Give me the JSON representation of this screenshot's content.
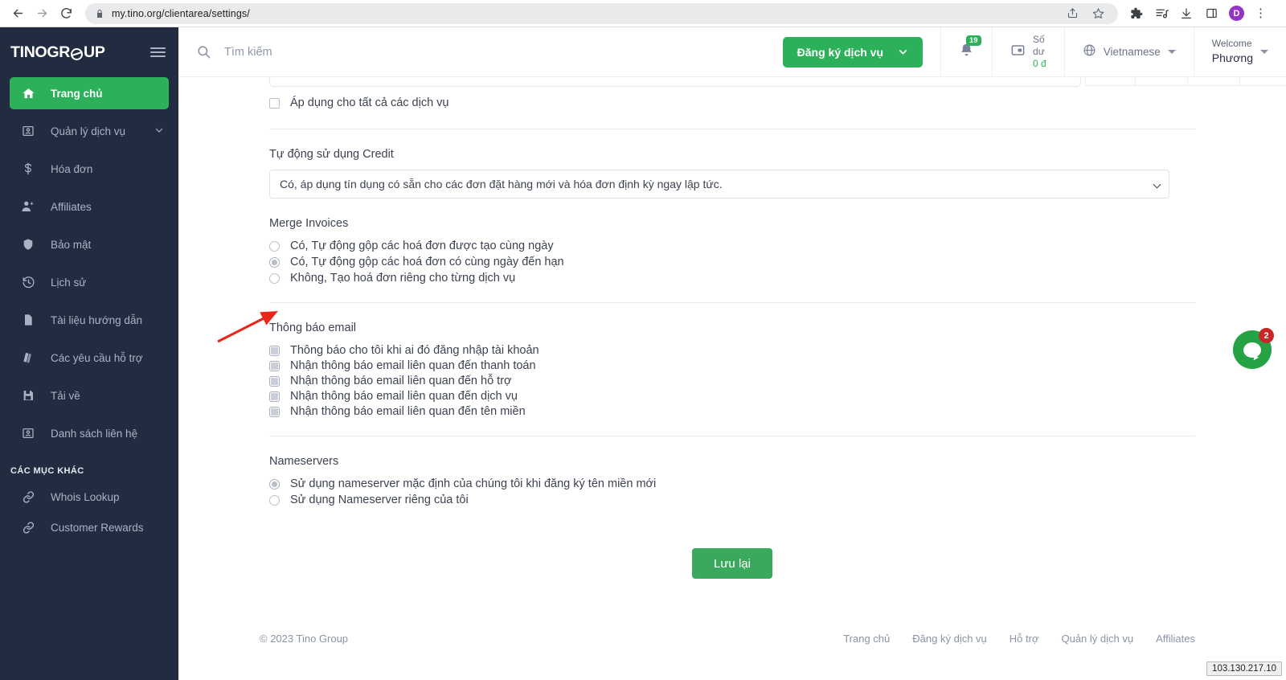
{
  "browser": {
    "back_icon": "back-arrow-icon",
    "forward_icon": "forward-arrow-icon",
    "reload_icon": "reload-icon",
    "url": "my.tino.org/clientarea/settings/",
    "lock_icon": "lock-icon",
    "share_icon": "share-icon",
    "bookmark_icon": "star-icon",
    "extensions_icon": "puzzle-piece-icon",
    "readinglist_icon": "reading-list-icon",
    "downloads_icon": "download-icon",
    "sidepanel_icon": "side-panel-icon",
    "profile_initial": "D",
    "menu_icon": "kebab-menu-icon"
  },
  "sidebar": {
    "brand": {
      "part1": "TINO",
      "part2": "GR",
      "part3": "UP"
    },
    "menu_icon": "hamburger-icon",
    "items": [
      {
        "label": "Trang chủ",
        "icon": "home-icon",
        "active": true,
        "chevron": false
      },
      {
        "label": "Quản lý dịch vụ",
        "icon": "id-card-icon",
        "active": false,
        "chevron": true
      },
      {
        "label": "Hóa đơn",
        "icon": "dollar-icon",
        "active": false,
        "chevron": false
      },
      {
        "label": "Affiliates",
        "icon": "user-plus-icon",
        "active": false,
        "chevron": false
      },
      {
        "label": "Bảo mật",
        "icon": "shield-icon",
        "active": false,
        "chevron": false
      },
      {
        "label": "Lịch sử",
        "icon": "history-clock-icon",
        "active": false,
        "chevron": false
      },
      {
        "label": "Tài liệu hướng dẫn",
        "icon": "document-icon",
        "active": false,
        "chevron": false
      },
      {
        "label": "Các yêu cầu hỗ trợ",
        "icon": "books-icon",
        "active": false,
        "chevron": false
      },
      {
        "label": "Tải về",
        "icon": "save-disk-icon",
        "active": false,
        "chevron": false
      },
      {
        "label": "Danh sách liên hệ",
        "icon": "contact-card-icon",
        "active": false,
        "chevron": false
      }
    ],
    "section_title": "CÁC MỤC KHÁC",
    "other_items": [
      {
        "label": "Whois Lookup",
        "icon": "link-icon"
      },
      {
        "label": "Customer Rewards",
        "icon": "link-icon"
      }
    ]
  },
  "topbar": {
    "search_placeholder": "Tìm kiếm",
    "search_value": "",
    "search_icon": "search-icon",
    "register_button": "Đăng ký dịch vụ",
    "register_chevron": "chevron-down-icon",
    "bell_icon": "bell-icon",
    "notification_count": "19",
    "wallet_icon": "wallet-icon",
    "balance_label_line1": "Số",
    "balance_label_line2": "dư",
    "balance_amount": "0 đ",
    "language_icon": "globe-icon",
    "language": "Vietnamese",
    "welcome_label": "Welcome",
    "user_name": "Phương"
  },
  "main": {
    "apply_all_services": {
      "label": "Áp dụng cho tất cả các dịch vụ",
      "checked": false
    },
    "auto_credit": {
      "label": "Tự động sử dụng Credit",
      "selected": "Có, áp dụng tín dụng có sẵn cho các đơn đặt hàng mới và hóa đơn định kỳ ngay lập tức."
    },
    "merge_invoices": {
      "title": "Merge Invoices",
      "options": [
        {
          "label": "Có, Tự động gộp các hoá đơn được tạo cùng ngày",
          "selected": false
        },
        {
          "label": "Có, Tự động gộp các hoá đơn có cùng ngày đến hạn",
          "selected": true
        },
        {
          "label": "Không, Tạo hoá đơn riêng cho từng dịch vụ",
          "selected": false
        }
      ]
    },
    "email_notifications": {
      "title": "Thông báo email",
      "options": [
        {
          "label": "Thông báo cho tôi khi ai đó đăng nhập tài khoản",
          "checked": true
        },
        {
          "label": "Nhận thông báo email liên quan đến thanh toán",
          "checked": true
        },
        {
          "label": "Nhận thông báo email liên quan đến hỗ trợ",
          "checked": true
        },
        {
          "label": "Nhận thông báo email liên quan đến dịch vụ",
          "checked": true
        },
        {
          "label": "Nhận thông báo email liên quan đến tên miền",
          "checked": true
        }
      ]
    },
    "nameservers": {
      "title": "Nameservers",
      "options": [
        {
          "label": "Sử dụng nameserver mặc định của chúng tôi khi đăng ký tên miền mới",
          "selected": true
        },
        {
          "label": "Sử dụng Nameserver riêng của tôi",
          "selected": false
        }
      ]
    },
    "save_button": "Lưu lại"
  },
  "footer": {
    "copyright": "© 2023 Tino Group",
    "links": [
      "Trang chủ",
      "Đăng ký dịch vụ",
      "Hỗ trợ",
      "Quản lý dịch vụ",
      "Affiliates"
    ]
  },
  "chat_widget": {
    "icon": "chat-bubble-icon",
    "unread_count": "2",
    "color": "#25a244",
    "badge_color": "#c62828"
  },
  "status_tooltip": {
    "ip": "103.130.217.10"
  },
  "annotation": {
    "arrow_color": "#e8271a",
    "points_to": "first-email-notification-checkbox"
  }
}
